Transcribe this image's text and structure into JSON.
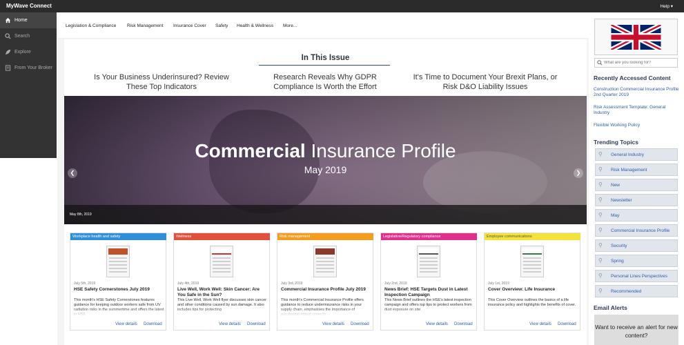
{
  "app": {
    "title": "MyWave Connect",
    "help_label": "Help ▾"
  },
  "sidebar": {
    "items": [
      {
        "label": "Home",
        "icon": "home-icon"
      },
      {
        "label": "Search",
        "icon": "search-icon"
      },
      {
        "label": "Explore",
        "icon": "rocket-icon"
      },
      {
        "label": "From Your Broker",
        "icon": "document-icon"
      }
    ]
  },
  "topnav": {
    "items": [
      "Legislation & Compliance",
      "Risk Management",
      "Insurance Cover",
      "Safety",
      "Health & Wellness",
      "More..."
    ]
  },
  "issue": {
    "title": "In This Issue",
    "articles": [
      "Is Your Business Underinsured? Review These Top Indicators",
      "Research Reveals Why GDPR Compliance Is Worth the Effort",
      "It's Time to Document Your Brexit Plans, or Risk D&O Liability Issues"
    ]
  },
  "hero": {
    "title_bold": "Commercial",
    "title_light": "Insurance Profile",
    "subtitle": "May 2019",
    "date": "May 8th, 2019"
  },
  "cards": [
    {
      "category": "Workplace health and safety",
      "color": "#2f8fd8",
      "date": "July 5th, 2019",
      "title": "HSE Safety Cornerstones July 2019",
      "desc": "This month's HSE Safety Cornerstones features guidance for keeping outdoor workers safe from UV radiation risks in the summertime and offers the latest in HSE",
      "view": "View details",
      "download": "Download"
    },
    {
      "category": "Wellness",
      "color": "#e0503a",
      "date": "July 4th, 2019",
      "title": "Live Well, Work Well: Skin Cancer: Are You Safe in the Sun?",
      "desc": "This Live Well, Work Well flyer discusses skin cancer and other conditions caused by sun damage. It also includes tips for protecting",
      "view": "View details",
      "download": "Download"
    },
    {
      "category": "Risk management",
      "color": "#f39c1e",
      "date": "July 3rd, 2019",
      "title": "Commercial Insurance Profile July 2019",
      "desc": "This month's Commercial Insurance Profile offers guidance to reduce underinsurance risks in your supply chain, emphasises the importance of purchasing robust cover to",
      "view": "View details",
      "download": "Download"
    },
    {
      "category": "Legislative/Regulatory compliance",
      "color": "#e02f8c",
      "date": "July 2nd, 2019",
      "title": "News Brief: HSE Targets Dust in Latest Inspection Campaign",
      "desc": "This News Brief outlines the HSE's latest inspection campaign and offers top tips to protect workers from dust exposure on site",
      "view": "View details",
      "download": "Download"
    },
    {
      "category": "Employee communications",
      "color": "#f2e23a",
      "date": "July 1st, 2019",
      "title": "Cover Overview: Life Insurance",
      "desc": "This Cover Overview outlines the basics of a life insurance policy and highlights the benefits of cover.",
      "view": "View details",
      "download": "Download"
    }
  ],
  "right": {
    "search_placeholder": "What are you looking for?",
    "recent_heading": "Recently Accessed Content",
    "recent": [
      "Construction Commercial Insurance Profile 2nd Quarter 2019",
      "Risk Assessment Template: General Industry",
      "Flexible Working Policy"
    ],
    "trending_heading": "Trending Topics",
    "topics": [
      "General Industry",
      "Risk Management",
      "New",
      "Newsletter",
      "May",
      "Commercial Insurance Profile",
      "Security",
      "Spring",
      "Personal Lines Perspectives",
      "Recommended"
    ],
    "alerts_heading": "Email Alerts",
    "alert_text": "Want to receive an alert for new content?"
  }
}
